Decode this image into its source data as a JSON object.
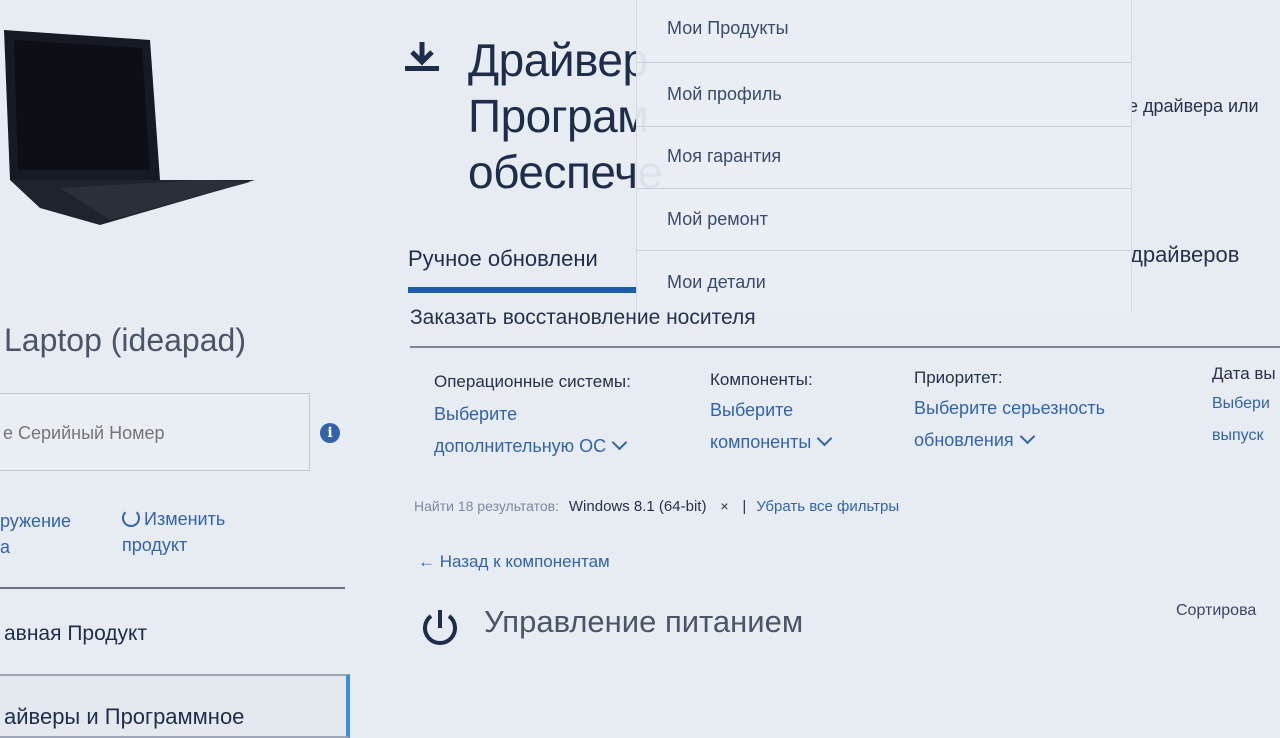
{
  "header": {
    "title": "Драйверы и Программное обеспечение",
    "title_lines": [
      "Драйвер",
      "Програм",
      "обеспече"
    ],
    "right_cut_text": "е драйвера или",
    "drivers_tab_cut": "драйверов"
  },
  "tabs": {
    "manual_update": "Ручное обновлени",
    "order_media": "Заказать восстановление носителя"
  },
  "filters": [
    {
      "label": "Операционные системы:",
      "line1": "Выберите",
      "line2": "дополнительную ОС"
    },
    {
      "label": "Компоненты:",
      "line1": "Выберите",
      "line2": "компоненты"
    },
    {
      "label": "Приоритет:",
      "line1": "Выберите серьезность",
      "line2": "обновления"
    },
    {
      "label": "Дата вы",
      "line1": "Выбери",
      "line2": "выпуск"
    }
  ],
  "results": {
    "count_text": "Найти 18 результатов:",
    "filter_value": "Windows 8.1 (64-bit)",
    "remove_symbol": "×",
    "separator": "|",
    "clear_all": "Убрать все фильтры"
  },
  "back_link": "← Назад к компонентам",
  "section": {
    "title": "Управление питанием",
    "sort_cut": "Сортирова"
  },
  "sidebar": {
    "product_name": "Laptop (ideapad)",
    "serial_placeholder": "е Серийный Номер",
    "detect_line1": "ружение",
    "detect_line2": "а",
    "change_line1": "Изменить",
    "change_line2": "продукт",
    "main_product": "авная Продукт",
    "nav_item": "айверы и Программное"
  },
  "dropdown": {
    "items": [
      "Мои Продукты",
      "Мой профиль",
      "Моя гарантия",
      "Мой ремонт",
      "Мои детали"
    ]
  },
  "colors": {
    "accent": "#1f5aa6",
    "link": "#3363a9",
    "text": "#26324b"
  }
}
